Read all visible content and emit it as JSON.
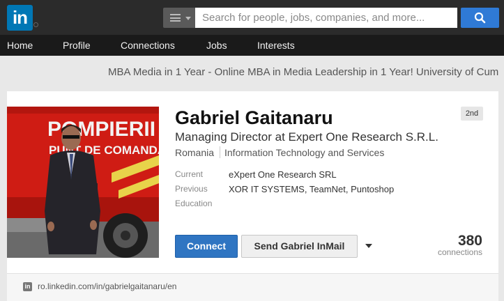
{
  "brand": {
    "logo_text": "in",
    "color": "#0077b5"
  },
  "search": {
    "placeholder": "Search for people, jobs, companies, and more...",
    "value": "",
    "type_icon": "menu-icon",
    "button_icon": "search-icon"
  },
  "nav": {
    "items": [
      {
        "label": "Home"
      },
      {
        "label": "Profile"
      },
      {
        "label": "Connections"
      },
      {
        "label": "Jobs"
      },
      {
        "label": "Interests"
      }
    ]
  },
  "ad": {
    "text": "MBA Media in 1 Year - Online MBA in Media Leadership in 1 Year! University of Cum"
  },
  "profile": {
    "name": "Gabriel Gaitanaru",
    "degree": "2nd",
    "headline": "Managing Director at Expert One Research S.R.L.",
    "location": "Romania",
    "industry": "Information Technology and Services",
    "details": {
      "current_label": "Current",
      "current_value": "eXpert One Research SRL",
      "previous_label": "Previous",
      "previous_value": "XOR IT SYSTEMS, TeamNet, Puntoshop",
      "education_label": "Education",
      "education_value": ""
    },
    "photo_text_line1": "POMPIERII",
    "photo_text_line2": "PUNT DE COMANDĂ"
  },
  "actions": {
    "connect_label": "Connect",
    "inmail_label": "Send Gabriel InMail",
    "more_icon": "caret-down-icon"
  },
  "connections": {
    "count": "380",
    "label": "connections"
  },
  "public_url": "ro.linkedin.com/in/gabrielgaitanaru/en",
  "colors": {
    "accent": "#2f75c2",
    "topbar": "#2b2b2b",
    "nav": "#1a1a1a"
  }
}
